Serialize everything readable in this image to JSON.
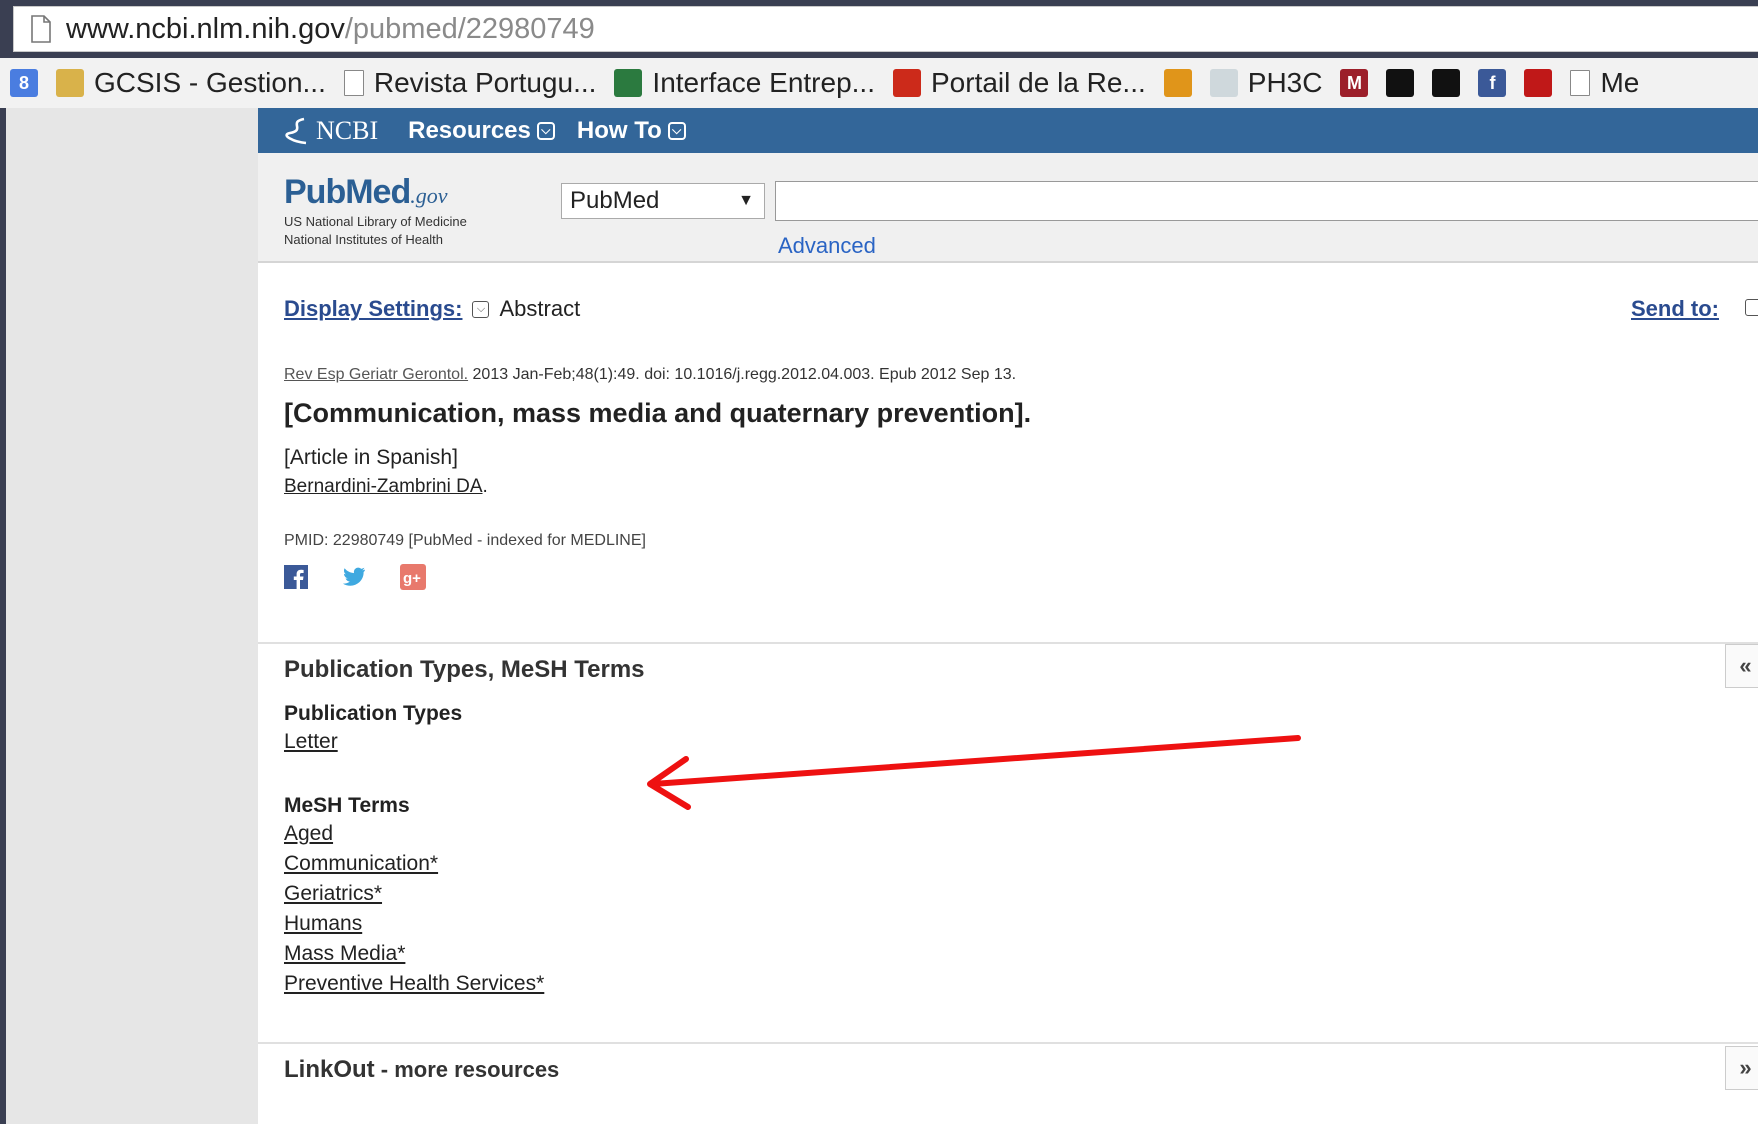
{
  "browser": {
    "url_host": "www.ncbi.nlm.nih.gov",
    "url_path": "/pubmed/22980749",
    "bookmarks": [
      {
        "label": "",
        "icon": "google-plus-icon",
        "color": "#4a7de0"
      },
      {
        "label": "GCSIS - Gestion...",
        "icon": "gcsis-icon",
        "color": "#d9b24a"
      },
      {
        "label": "Revista Portugu...",
        "icon": "page-icon",
        "color": "#888888"
      },
      {
        "label": "Interface Entrep...",
        "icon": "interface-icon",
        "color": "#2b7a3f"
      },
      {
        "label": "Portail de la Re...",
        "icon": "portail-icon",
        "color": "#cc2a1a"
      },
      {
        "label": "",
        "icon": "bmj-icon",
        "color": "#e0951a"
      },
      {
        "label": "PH3C",
        "icon": "ph3c-icon",
        "color": "#cfd8dc"
      },
      {
        "label": "",
        "icon": "m3-icon",
        "color": "#9c1f2a"
      },
      {
        "label": "",
        "icon": "black-logo-icon",
        "color": "#111111"
      },
      {
        "label": "",
        "icon": "jmt-icon",
        "color": "#111111"
      },
      {
        "label": "",
        "icon": "facebook-icon",
        "color": "#3b5998"
      },
      {
        "label": "",
        "icon": "shop-icon",
        "color": "#c01818"
      },
      {
        "label": "Me",
        "icon": "page-icon",
        "color": "#888888"
      }
    ]
  },
  "ncbi": {
    "logo": "NCBI",
    "resources": "Resources",
    "howto": "How To"
  },
  "search": {
    "logo_word": "PubMed",
    "logo_gov": ".gov",
    "logo_sub1": "US National Library of Medicine",
    "logo_sub2": "National Institutes of Health",
    "database": "PubMed",
    "query": "",
    "advanced": "Advanced"
  },
  "display": {
    "settings_label": "Display Settings:",
    "settings_value": "Abstract",
    "send_to": "Send to:"
  },
  "article": {
    "journal": "Rev Esp Geriatr Gerontol.",
    "citation": " 2013 Jan-Feb;48(1):49. doi: 10.1016/j.regg.2012.04.003. Epub 2012 Sep 13.",
    "title": "[Communication, mass media and quaternary prevention].",
    "language": "[Article in Spanish]",
    "author": "Bernardini-Zambrini DA",
    "author_suffix": ".",
    "pmid": "PMID: 22980749 [PubMed - indexed for MEDLINE]"
  },
  "pubtypes": {
    "section_title": "Publication Types, MeSH Terms",
    "types_heading": "Publication Types",
    "types": [
      "Letter"
    ],
    "mesh_heading": "MeSH Terms",
    "mesh": [
      "Aged",
      "Communication*",
      "Geriatrics*",
      "Humans",
      "Mass Media*",
      "Preventive Health Services*"
    ]
  },
  "linkout": {
    "section_title": "LinkOut",
    "section_suffix": " - more resources"
  },
  "annotation": {
    "arrow_color": "#ee1111"
  }
}
